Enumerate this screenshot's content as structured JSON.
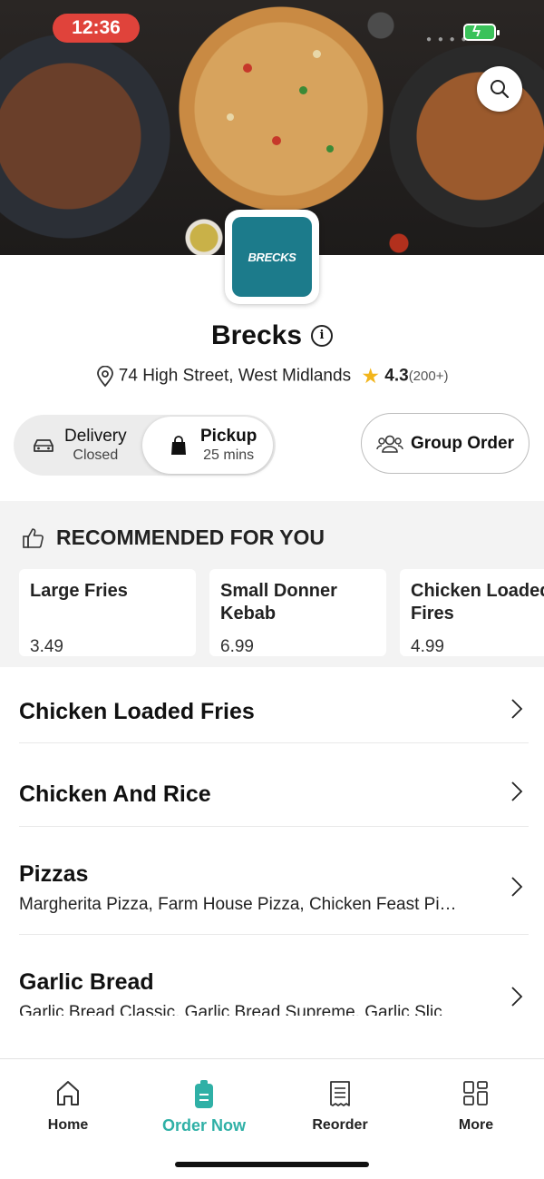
{
  "status_bar": {
    "time": "12:36"
  },
  "store": {
    "logo_text": "BRECKS",
    "name": "Brecks",
    "address": "74 High Street, West Midlands",
    "rating": "4.3",
    "rating_count": "(200+)"
  },
  "order_mode": {
    "delivery": {
      "label": "Delivery",
      "status": "Closed"
    },
    "pickup": {
      "label": "Pickup",
      "status": "25 mins"
    },
    "selected": "pickup",
    "group_order_label": "Group Order"
  },
  "recommended": {
    "title": "RECOMMENDED FOR YOU",
    "items": [
      {
        "name": "Large Fries",
        "price": "3.49"
      },
      {
        "name": "Small Donner Kebab",
        "price": "6.99"
      },
      {
        "name": "Chicken Loaded Fires",
        "price": "4.99"
      }
    ]
  },
  "categories": [
    {
      "title": "Chicken Loaded Fries",
      "subtitle": ""
    },
    {
      "title": "Chicken And Rice",
      "subtitle": ""
    },
    {
      "title": "Pizzas",
      "subtitle": "Margherita Pizza, Farm House Pizza, Chicken Feast Pi…"
    },
    {
      "title": "Garlic Bread",
      "subtitle": "Garlic Bread Classic, Garlic Bread Supreme, Garlic Slic"
    }
  ],
  "tabbar": {
    "items": [
      {
        "label": "Home",
        "icon": "home-icon"
      },
      {
        "label": "Order Now",
        "icon": "order-icon"
      },
      {
        "label": "Reorder",
        "icon": "receipt-icon"
      },
      {
        "label": "More",
        "icon": "grid-icon"
      }
    ],
    "active": "Order Now",
    "accent_color": "#2fb0a6"
  },
  "colors": {
    "brand": "#1c7b8b",
    "status_time_bg": "#e0433b",
    "star": "#f2b51c"
  }
}
